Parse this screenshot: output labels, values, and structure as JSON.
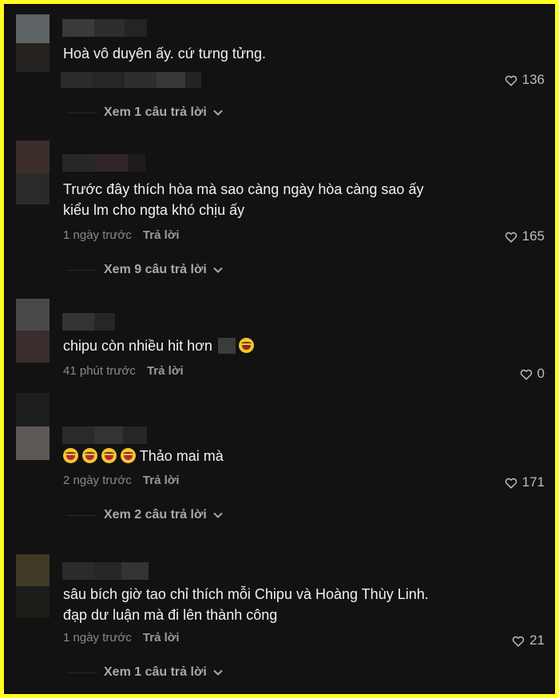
{
  "comments": [
    {
      "text": "Hoà vô duyên ấy. cứ tưng tửng.",
      "time": "",
      "reply_label": "",
      "likes": "136",
      "view_replies": "Xem 1 câu trả lời"
    },
    {
      "text": "Trước đây thích hòa mà sao càng ngày hòa càng sao ấy\nkiểu lm cho ngta khó chịu ấy",
      "time": "1 ngày trước",
      "reply_label": "Trả lời",
      "likes": "165",
      "view_replies": "Xem 9 câu trả lời"
    },
    {
      "text": "chipu còn nhiều hit hơn",
      "time": "41 phút trước",
      "reply_label": "Trả lời",
      "likes": "0",
      "view_replies": ""
    },
    {
      "text": "Thảo mai mà",
      "time": "2 ngày trước",
      "reply_label": "Trả lời",
      "likes": "171",
      "view_replies": "Xem 2 câu trả lời"
    },
    {
      "text": "sâu bích giờ tao chỉ thích mỗi Chipu và Hoàng Thùy Linh.\nđạp dư luận mà đi lên thành công",
      "time": "1 ngày trước",
      "reply_label": "Trả lời",
      "likes": "21",
      "view_replies": "Xem 1 câu trả lời"
    }
  ],
  "colors": {
    "frame_border": "#ffff1f",
    "background": "#121212",
    "text": "#f1f1f1",
    "meta": "#8a8a8a"
  },
  "icons": {
    "like": "heart-outline-icon",
    "expand": "chevron-down-icon",
    "emoji_laugh": "grinning-squinting-face-icon",
    "emoji_tongue": "squinting-face-with-tongue-icon"
  }
}
